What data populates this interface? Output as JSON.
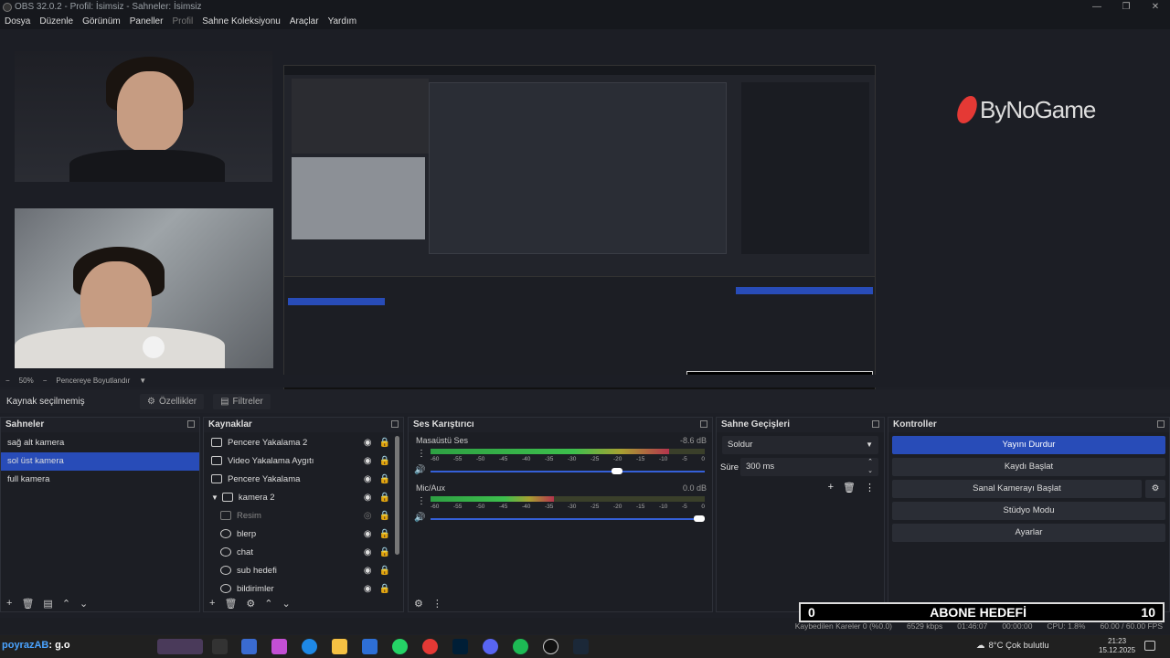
{
  "window": {
    "title": "OBS 32.0.2 - Profil: İsimsiz - Sahneler: İsimsiz"
  },
  "menu": [
    {
      "label": "Dosya",
      "enabled": true
    },
    {
      "label": "Düzenle",
      "enabled": true
    },
    {
      "label": "Görünüm",
      "enabled": true
    },
    {
      "label": "Paneller",
      "enabled": true
    },
    {
      "label": "Profil",
      "enabled": false
    },
    {
      "label": "Sahne Koleksiyonu",
      "enabled": true
    },
    {
      "label": "Araçlar",
      "enabled": true
    },
    {
      "label": "Yardım",
      "enabled": true
    }
  ],
  "preview": {
    "zoom": "50%",
    "fit_label": "Pencereye Boyutlandır",
    "logo_text": "ByNoGame"
  },
  "source_bar": {
    "status": "Kaynak seçilmemiş",
    "properties": "Özellikler",
    "filters": "Filtreler"
  },
  "scenes": {
    "title": "Sahneler",
    "items": [
      {
        "label": "sağ alt kamera",
        "selected": false
      },
      {
        "label": "sol üst kamera",
        "selected": true
      },
      {
        "label": "full kamera",
        "selected": false
      }
    ]
  },
  "sources": {
    "title": "Kaynaklar",
    "items": [
      {
        "label": "Pencere Yakalama 2",
        "icon": "window-capture-icon",
        "dim": false,
        "indent": false
      },
      {
        "label": "Video Yakalama Aygıtı",
        "icon": "camera-icon",
        "dim": false,
        "indent": false
      },
      {
        "label": "Pencere Yakalama",
        "icon": "window-capture-icon",
        "dim": false,
        "indent": false
      },
      {
        "label": "kamera 2",
        "icon": "folder-icon",
        "dim": false,
        "indent": false
      },
      {
        "label": "Resim",
        "icon": "image-icon",
        "dim": true,
        "indent": true
      },
      {
        "label": "blerp",
        "icon": "browser-icon",
        "dim": false,
        "indent": true
      },
      {
        "label": "chat",
        "icon": "browser-icon",
        "dim": false,
        "indent": true
      },
      {
        "label": "sub hedefi",
        "icon": "browser-icon",
        "dim": false,
        "indent": true
      },
      {
        "label": "bildirimler",
        "icon": "browser-icon",
        "dim": false,
        "indent": true
      }
    ]
  },
  "mixer": {
    "title": "Ses Karıştırıcı",
    "ticks": [
      "-60",
      "-55",
      "-50",
      "-45",
      "-40",
      "-35",
      "-30",
      "-25",
      "-20",
      "-15",
      "-10",
      "-5",
      "0"
    ],
    "channels": [
      {
        "name": "Masaüstü Ses",
        "db": "-8.6 dB",
        "level": 0.87,
        "volume": 0.7
      },
      {
        "name": "Mic/Aux",
        "db": "0.0 dB",
        "level": 0.45,
        "volume": 1.0
      }
    ]
  },
  "transitions": {
    "title": "Sahne Geçişleri",
    "type": "Soldur",
    "duration_label": "Süre",
    "duration": "300 ms"
  },
  "controls": {
    "title": "Kontroller",
    "stop_stream": "Yayını Durdur",
    "start_recording": "Kaydı Başlat",
    "start_virtualcam": "Sanal Kamerayı Başlat",
    "studio_mode": "Stüdyo Modu",
    "settings": "Ayarlar"
  },
  "goal": {
    "left": "0",
    "label": "ABONE HEDEFİ",
    "right": "10"
  },
  "status": {
    "dropped": "Kaybedilen Kareler 0 (%0.0)",
    "bitrate": "6529 kbps",
    "stream_time": "01:46:07",
    "rec_time": "00:00:00",
    "cpu": "CPU: 1.8%",
    "fps": "60.00 / 60.00 FPS"
  },
  "taskbar": {
    "brand_prefix": "poyrazAB",
    "brand_suffix": ": g.o",
    "weather": "8°C  Çok bulutlu",
    "time": "21:23",
    "date": "15.12.2025"
  },
  "colors": {
    "accent": "#284cb8",
    "panel": "#1c1e24",
    "meter_green": "#3dbf4d",
    "meter_red": "#b4344d"
  }
}
